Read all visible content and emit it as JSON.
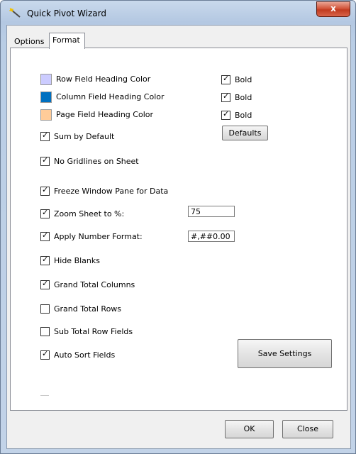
{
  "window": {
    "title": "Quick Pivot Wizard",
    "close_label": "x"
  },
  "tabs": [
    {
      "label": "Options",
      "active": false
    },
    {
      "label": "Format",
      "active": true
    }
  ],
  "colors": [
    {
      "label": "Row Field Heading Color",
      "swatch": "#ccccff",
      "bold_label": "Bold",
      "bold": true
    },
    {
      "label": "Column Field Heading Color",
      "swatch": "#0070c0",
      "bold_label": "Bold",
      "bold": true
    },
    {
      "label": "Page Field Heading Color",
      "swatch": "#ffcc99",
      "bold_label": "Bold",
      "bold": true
    }
  ],
  "defaults_button": "Defaults",
  "checkboxes": [
    {
      "label": "Sum by Default",
      "checked": true
    },
    {
      "label": "No Gridlines on Sheet",
      "checked": true
    },
    {
      "label": "Freeze Window Pane for Data",
      "checked": true
    },
    {
      "label": "Zoom Sheet to %:",
      "checked": true
    },
    {
      "label": "Apply Number Format:",
      "checked": true
    },
    {
      "label": "Hide Blanks",
      "checked": true
    },
    {
      "label": "Grand Total Columns",
      "checked": true
    },
    {
      "label": "Grand Total Rows",
      "checked": false
    },
    {
      "label": "Sub Total Row Fields",
      "checked": false
    },
    {
      "label": "Auto Sort Fields",
      "checked": true
    }
  ],
  "zoom_value": "75",
  "number_format_value": "#,##0.00",
  "save_settings_button": "Save Settings",
  "ok_button": "OK",
  "close_button": "Close"
}
